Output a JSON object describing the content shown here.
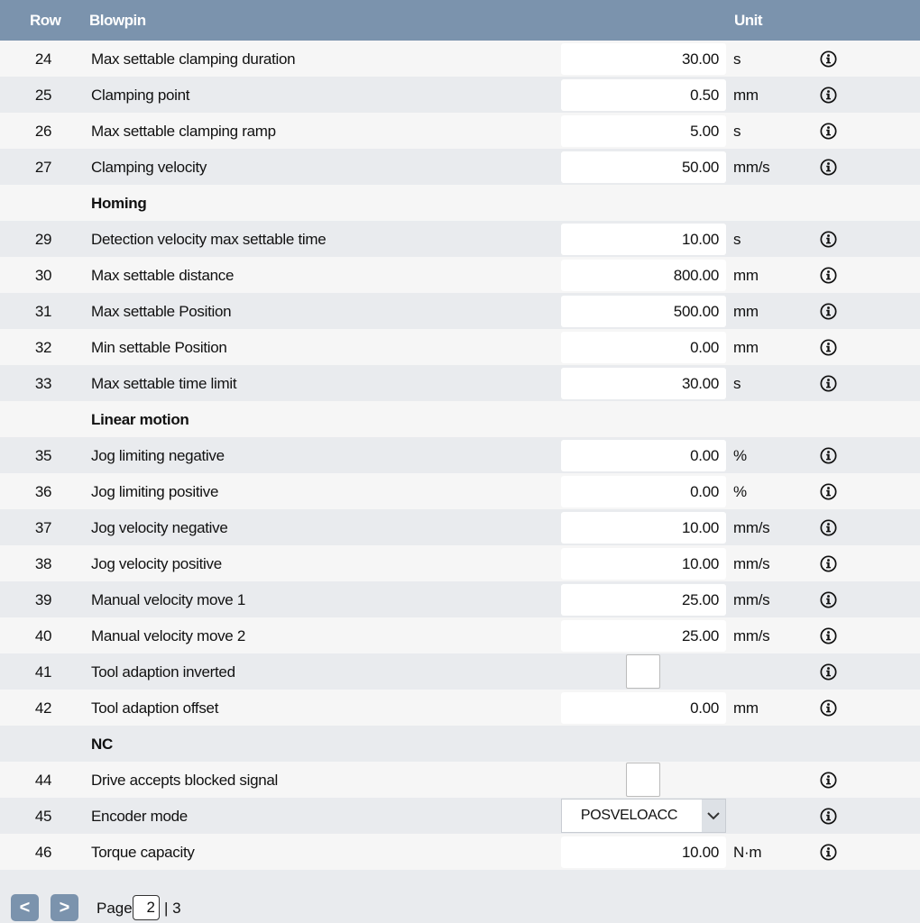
{
  "header": {
    "row": "Row",
    "name": "Blowpin",
    "unit": "Unit"
  },
  "rows": [
    {
      "num": "24",
      "name": "Max settable clamping duration",
      "value": "30.00",
      "unit": "s",
      "kind": "value"
    },
    {
      "num": "25",
      "name": "Clamping point",
      "value": "0.50",
      "unit": "mm",
      "kind": "value"
    },
    {
      "num": "26",
      "name": "Max settable clamping ramp",
      "value": "5.00",
      "unit": "s",
      "kind": "value"
    },
    {
      "num": "27",
      "name": "Clamping velocity",
      "value": "50.00",
      "unit": "mm/s",
      "kind": "value"
    },
    {
      "num": "",
      "name": "Homing",
      "kind": "section"
    },
    {
      "num": "29",
      "name": "Detection velocity max settable time",
      "value": "10.00",
      "unit": "s",
      "kind": "value"
    },
    {
      "num": "30",
      "name": "Max settable distance",
      "value": "800.00",
      "unit": "mm",
      "kind": "value"
    },
    {
      "num": "31",
      "name": "Max settable Position",
      "value": "500.00",
      "unit": "mm",
      "kind": "value"
    },
    {
      "num": "32",
      "name": "Min settable Position",
      "value": "0.00",
      "unit": "mm",
      "kind": "value"
    },
    {
      "num": "33",
      "name": "Max settable time limit",
      "value": "30.00",
      "unit": "s",
      "kind": "value"
    },
    {
      "num": "",
      "name": "Linear motion",
      "kind": "section"
    },
    {
      "num": "35",
      "name": "Jog limiting negative",
      "value": "0.00",
      "unit": "%",
      "kind": "value"
    },
    {
      "num": "36",
      "name": "Jog limiting positive",
      "value": "0.00",
      "unit": "%",
      "kind": "value"
    },
    {
      "num": "37",
      "name": "Jog velocity negative",
      "value": "10.00",
      "unit": "mm/s",
      "kind": "value"
    },
    {
      "num": "38",
      "name": "Jog velocity positive",
      "value": "10.00",
      "unit": "mm/s",
      "kind": "value"
    },
    {
      "num": "39",
      "name": "Manual velocity move 1",
      "value": "25.00",
      "unit": "mm/s",
      "kind": "value"
    },
    {
      "num": "40",
      "name": "Manual velocity move 2",
      "value": "25.00",
      "unit": "mm/s",
      "kind": "value"
    },
    {
      "num": "41",
      "name": "Tool adaption inverted",
      "checked": false,
      "kind": "checkbox"
    },
    {
      "num": "42",
      "name": "Tool adaption offset",
      "value": "0.00",
      "unit": "mm",
      "kind": "value"
    },
    {
      "num": "",
      "name": "NC",
      "kind": "section"
    },
    {
      "num": "44",
      "name": "Drive accepts blocked signal",
      "checked": false,
      "kind": "checkbox"
    },
    {
      "num": "45",
      "name": "Encoder mode",
      "value": "POSVELOACC",
      "kind": "select"
    },
    {
      "num": "46",
      "name": "Torque capacity",
      "value": "10.00",
      "unit": "N·m",
      "kind": "value"
    }
  ],
  "pager": {
    "prev_label": "<",
    "next_label": ">",
    "page_label": "Page",
    "current_page": "2",
    "total_label": "| 3"
  },
  "icons": {
    "info": "info-circle-icon",
    "dropdown": "chevron-down-icon"
  },
  "colors": {
    "header_bg": "#7b93ad",
    "row_light": "#f6f6f6",
    "row_dark": "#e9ebee"
  }
}
